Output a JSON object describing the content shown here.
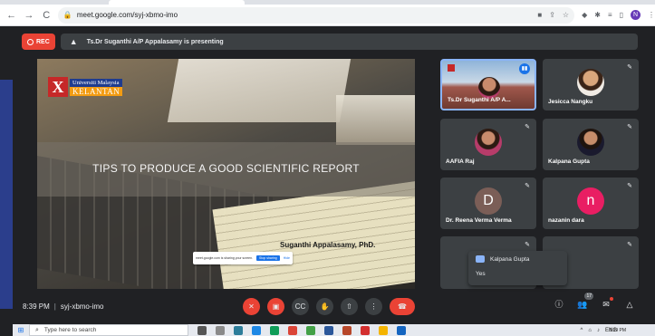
{
  "browser": {
    "url": "meet.google.com/syj-xbmo-imo",
    "profile_initial": "N",
    "nav": {
      "back": "←",
      "forward": "→",
      "reload": "C"
    }
  },
  "meet": {
    "rec_label": "REC",
    "presenting_text": "Ts.Dr Suganthi A/P Appalasamy is presenting",
    "slide": {
      "university_name": "Universiti Malaysia",
      "university_state": "KELANTAN",
      "university_logo_letter": "X",
      "title": "TIPS TO PRODUCE A GOOD SCIENTIFIC REPORT",
      "author": "Suganthi Appalasamy, PhD.",
      "share_text": "meet.google.com is sharing your screen.",
      "stop_sharing": "Stop sharing",
      "hide": "Hide"
    },
    "participants": [
      {
        "name": "Ts.Dr Suganthi A/P A...",
        "initial": ""
      },
      {
        "name": "Jesicca Nangku",
        "initial": ""
      },
      {
        "name": "AAFIA Raj",
        "initial": ""
      },
      {
        "name": "Kalpana Gupta",
        "initial": ""
      },
      {
        "name": "Dr. Reena Verma Verma",
        "initial": "D"
      },
      {
        "name": "nazanin dara",
        "initial": "n"
      }
    ],
    "chat_toast": {
      "sender": "Kalpana Gupta",
      "message": "Yes"
    },
    "time": "8:39 PM",
    "separator": "|",
    "meeting_code": "syj-xbmo-imo",
    "people_count": "17",
    "colors": {
      "accent": "#1a73e8",
      "danger": "#ea4335",
      "surface": "#3c4043",
      "bg": "#202124"
    }
  },
  "taskbar": {
    "search_placeholder": "Type here to search",
    "lang": "ENG",
    "clock_time": "8:39 PM"
  }
}
